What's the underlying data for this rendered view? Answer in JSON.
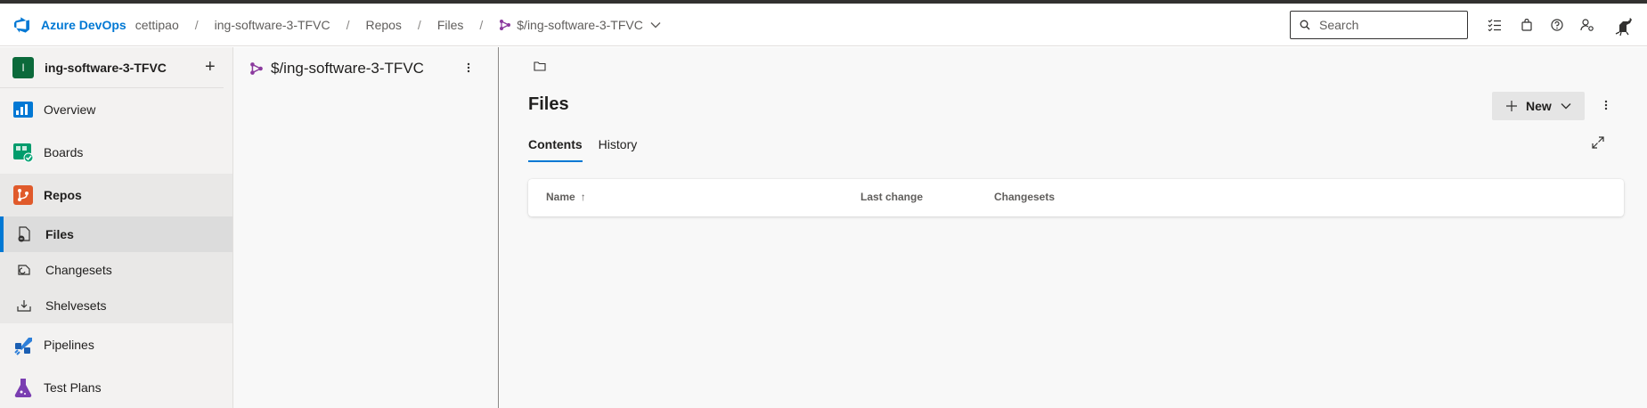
{
  "header": {
    "brand": "Azure DevOps",
    "org": "cettipao",
    "separator": "/",
    "breadcrumbs": [
      "ing-software-3-TFVC",
      "Repos",
      "Files"
    ],
    "repo_selector": "$/ing-software-3-TFVC",
    "search_placeholder": "Search",
    "icons": [
      "work-items-icon",
      "marketplace-bag-icon",
      "help-icon",
      "user-settings-icon",
      "avatar"
    ]
  },
  "sidebar": {
    "project_initial": "I",
    "project_name": "ing-software-3-TFVC",
    "add_label": "+",
    "items": [
      {
        "label": "Overview",
        "icon": "overview-icon"
      },
      {
        "label": "Boards",
        "icon": "boards-icon"
      },
      {
        "label": "Repos",
        "icon": "repos-icon"
      },
      {
        "label": "Pipelines",
        "icon": "pipelines-icon"
      },
      {
        "label": "Test Plans",
        "icon": "test-plans-icon"
      }
    ],
    "repos_sub": [
      {
        "label": "Files",
        "icon": "files-icon",
        "active": true
      },
      {
        "label": "Changesets",
        "icon": "changesets-icon"
      },
      {
        "label": "Shelvesets",
        "icon": "shelvesets-icon"
      }
    ]
  },
  "tree": {
    "root": "$/ing-software-3-TFVC"
  },
  "main": {
    "title": "Files",
    "new_button": "New",
    "tabs": [
      "Contents",
      "History"
    ],
    "active_tab": "Contents",
    "columns": [
      "Name",
      "Last change",
      "Changesets"
    ],
    "sort_indicator": "↑"
  },
  "colors": {
    "accent": "#0078d4",
    "project_avatar": "#0b6a3b",
    "repo_purple": "#8b3a9e"
  }
}
